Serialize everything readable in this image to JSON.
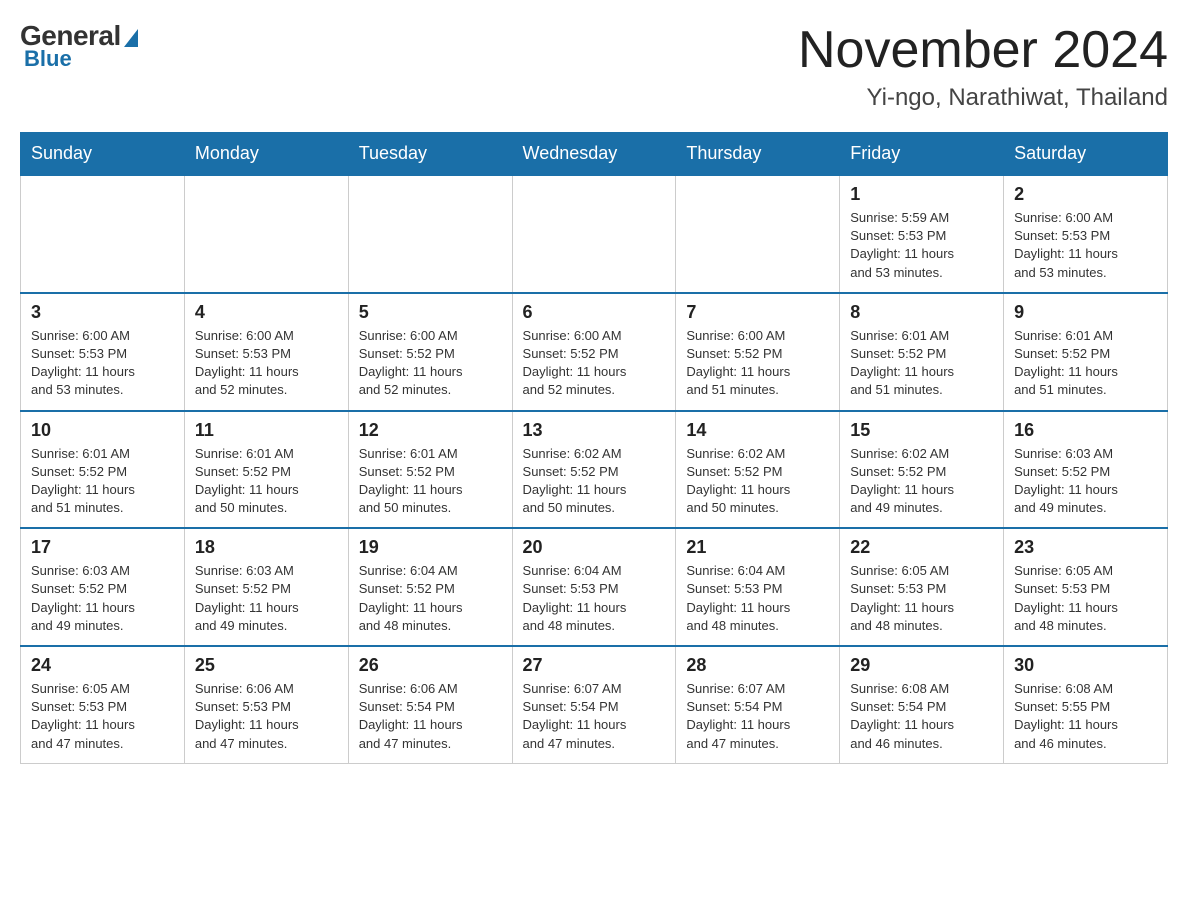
{
  "logo": {
    "general": "General",
    "blue": "Blue"
  },
  "header": {
    "month": "November 2024",
    "location": "Yi-ngo, Narathiwat, Thailand"
  },
  "weekdays": [
    "Sunday",
    "Monday",
    "Tuesday",
    "Wednesday",
    "Thursday",
    "Friday",
    "Saturday"
  ],
  "weeks": [
    [
      {
        "day": "",
        "info": ""
      },
      {
        "day": "",
        "info": ""
      },
      {
        "day": "",
        "info": ""
      },
      {
        "day": "",
        "info": ""
      },
      {
        "day": "",
        "info": ""
      },
      {
        "day": "1",
        "info": "Sunrise: 5:59 AM\nSunset: 5:53 PM\nDaylight: 11 hours\nand 53 minutes."
      },
      {
        "day": "2",
        "info": "Sunrise: 6:00 AM\nSunset: 5:53 PM\nDaylight: 11 hours\nand 53 minutes."
      }
    ],
    [
      {
        "day": "3",
        "info": "Sunrise: 6:00 AM\nSunset: 5:53 PM\nDaylight: 11 hours\nand 53 minutes."
      },
      {
        "day": "4",
        "info": "Sunrise: 6:00 AM\nSunset: 5:53 PM\nDaylight: 11 hours\nand 52 minutes."
      },
      {
        "day": "5",
        "info": "Sunrise: 6:00 AM\nSunset: 5:52 PM\nDaylight: 11 hours\nand 52 minutes."
      },
      {
        "day": "6",
        "info": "Sunrise: 6:00 AM\nSunset: 5:52 PM\nDaylight: 11 hours\nand 52 minutes."
      },
      {
        "day": "7",
        "info": "Sunrise: 6:00 AM\nSunset: 5:52 PM\nDaylight: 11 hours\nand 51 minutes."
      },
      {
        "day": "8",
        "info": "Sunrise: 6:01 AM\nSunset: 5:52 PM\nDaylight: 11 hours\nand 51 minutes."
      },
      {
        "day": "9",
        "info": "Sunrise: 6:01 AM\nSunset: 5:52 PM\nDaylight: 11 hours\nand 51 minutes."
      }
    ],
    [
      {
        "day": "10",
        "info": "Sunrise: 6:01 AM\nSunset: 5:52 PM\nDaylight: 11 hours\nand 51 minutes."
      },
      {
        "day": "11",
        "info": "Sunrise: 6:01 AM\nSunset: 5:52 PM\nDaylight: 11 hours\nand 50 minutes."
      },
      {
        "day": "12",
        "info": "Sunrise: 6:01 AM\nSunset: 5:52 PM\nDaylight: 11 hours\nand 50 minutes."
      },
      {
        "day": "13",
        "info": "Sunrise: 6:02 AM\nSunset: 5:52 PM\nDaylight: 11 hours\nand 50 minutes."
      },
      {
        "day": "14",
        "info": "Sunrise: 6:02 AM\nSunset: 5:52 PM\nDaylight: 11 hours\nand 50 minutes."
      },
      {
        "day": "15",
        "info": "Sunrise: 6:02 AM\nSunset: 5:52 PM\nDaylight: 11 hours\nand 49 minutes."
      },
      {
        "day": "16",
        "info": "Sunrise: 6:03 AM\nSunset: 5:52 PM\nDaylight: 11 hours\nand 49 minutes."
      }
    ],
    [
      {
        "day": "17",
        "info": "Sunrise: 6:03 AM\nSunset: 5:52 PM\nDaylight: 11 hours\nand 49 minutes."
      },
      {
        "day": "18",
        "info": "Sunrise: 6:03 AM\nSunset: 5:52 PM\nDaylight: 11 hours\nand 49 minutes."
      },
      {
        "day": "19",
        "info": "Sunrise: 6:04 AM\nSunset: 5:52 PM\nDaylight: 11 hours\nand 48 minutes."
      },
      {
        "day": "20",
        "info": "Sunrise: 6:04 AM\nSunset: 5:53 PM\nDaylight: 11 hours\nand 48 minutes."
      },
      {
        "day": "21",
        "info": "Sunrise: 6:04 AM\nSunset: 5:53 PM\nDaylight: 11 hours\nand 48 minutes."
      },
      {
        "day": "22",
        "info": "Sunrise: 6:05 AM\nSunset: 5:53 PM\nDaylight: 11 hours\nand 48 minutes."
      },
      {
        "day": "23",
        "info": "Sunrise: 6:05 AM\nSunset: 5:53 PM\nDaylight: 11 hours\nand 48 minutes."
      }
    ],
    [
      {
        "day": "24",
        "info": "Sunrise: 6:05 AM\nSunset: 5:53 PM\nDaylight: 11 hours\nand 47 minutes."
      },
      {
        "day": "25",
        "info": "Sunrise: 6:06 AM\nSunset: 5:53 PM\nDaylight: 11 hours\nand 47 minutes."
      },
      {
        "day": "26",
        "info": "Sunrise: 6:06 AM\nSunset: 5:54 PM\nDaylight: 11 hours\nand 47 minutes."
      },
      {
        "day": "27",
        "info": "Sunrise: 6:07 AM\nSunset: 5:54 PM\nDaylight: 11 hours\nand 47 minutes."
      },
      {
        "day": "28",
        "info": "Sunrise: 6:07 AM\nSunset: 5:54 PM\nDaylight: 11 hours\nand 47 minutes."
      },
      {
        "day": "29",
        "info": "Sunrise: 6:08 AM\nSunset: 5:54 PM\nDaylight: 11 hours\nand 46 minutes."
      },
      {
        "day": "30",
        "info": "Sunrise: 6:08 AM\nSunset: 5:55 PM\nDaylight: 11 hours\nand 46 minutes."
      }
    ]
  ]
}
